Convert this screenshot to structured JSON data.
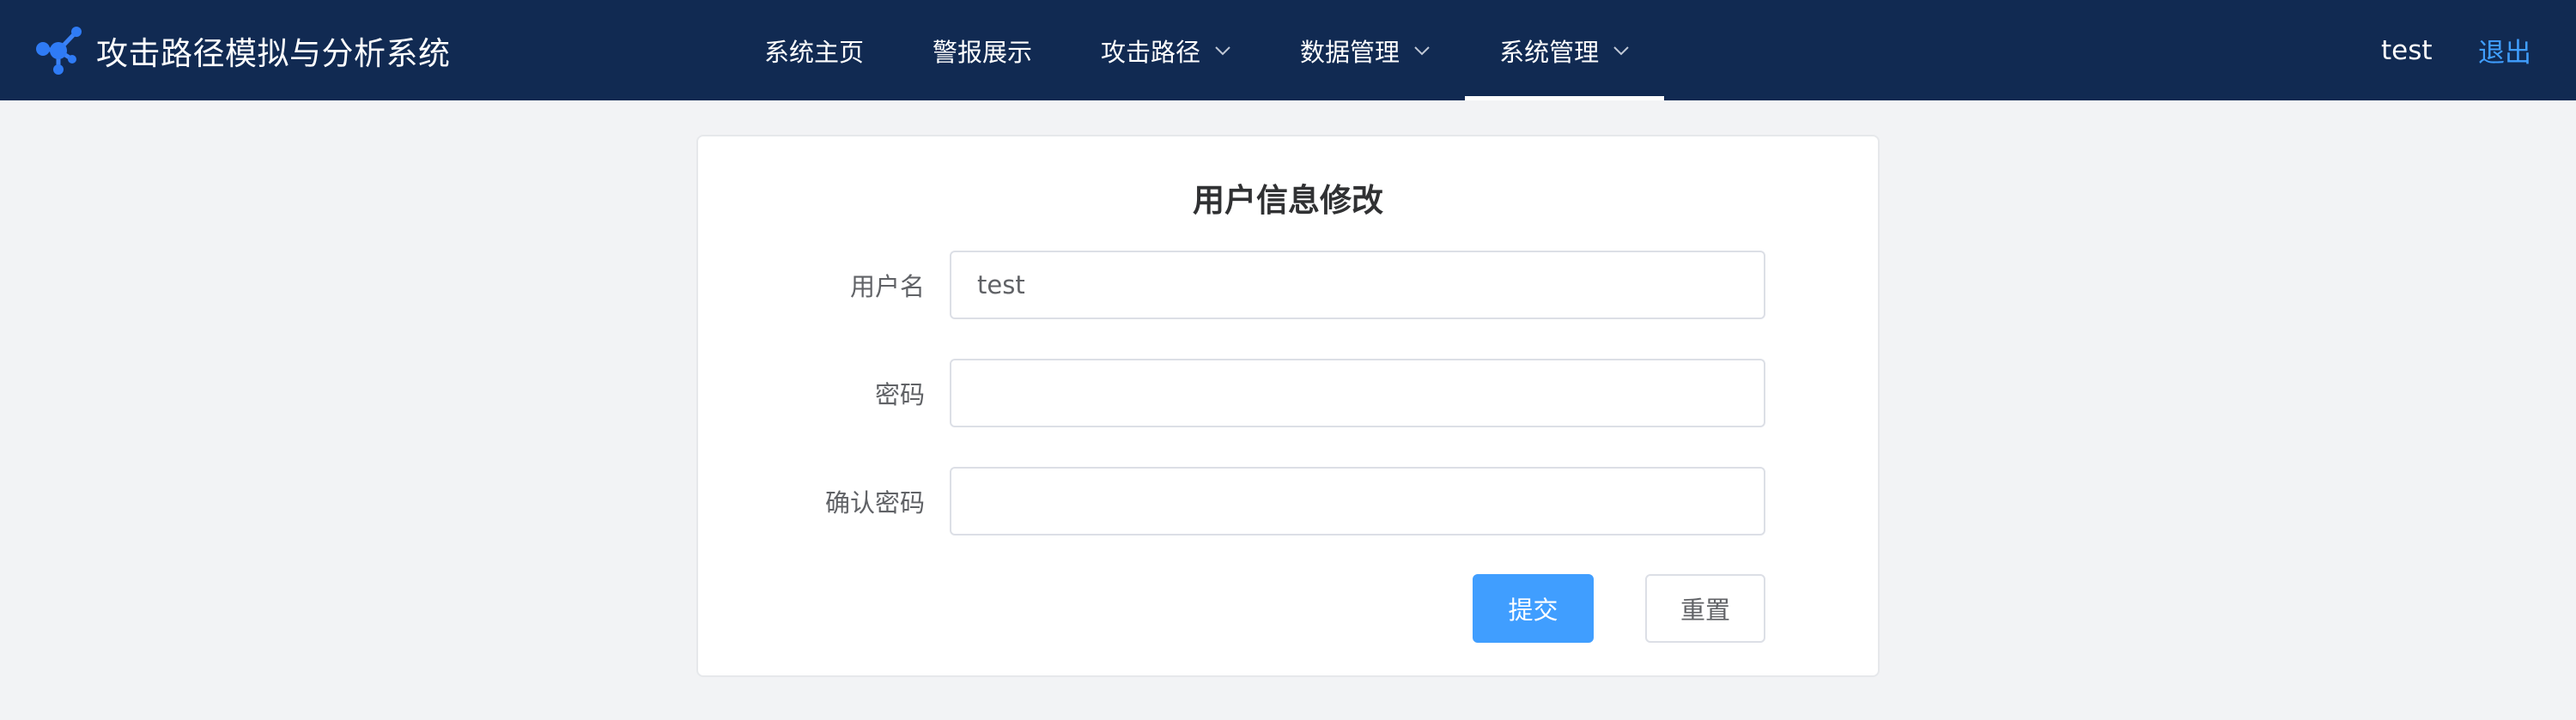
{
  "header": {
    "app_title": "攻击路径模拟与分析系统",
    "brand_color": "#112a52",
    "accent_color": "#409eff",
    "logo_icon": "molecule-network-icon",
    "nav": [
      {
        "label": "系统主页",
        "has_dropdown": false,
        "active": false
      },
      {
        "label": "警报展示",
        "has_dropdown": false,
        "active": false
      },
      {
        "label": "攻击路径",
        "has_dropdown": true,
        "active": false
      },
      {
        "label": "数据管理",
        "has_dropdown": true,
        "active": false
      },
      {
        "label": "系统管理",
        "has_dropdown": true,
        "active": true
      }
    ],
    "user": "test",
    "logout_label": "退出"
  },
  "form": {
    "title": "用户信息修改",
    "username_label": "用户名",
    "username_value": "test",
    "password_label": "密码",
    "password_value": "",
    "confirm_label": "确认密码",
    "confirm_value": "",
    "submit_label": "提交",
    "reset_label": "重置"
  }
}
